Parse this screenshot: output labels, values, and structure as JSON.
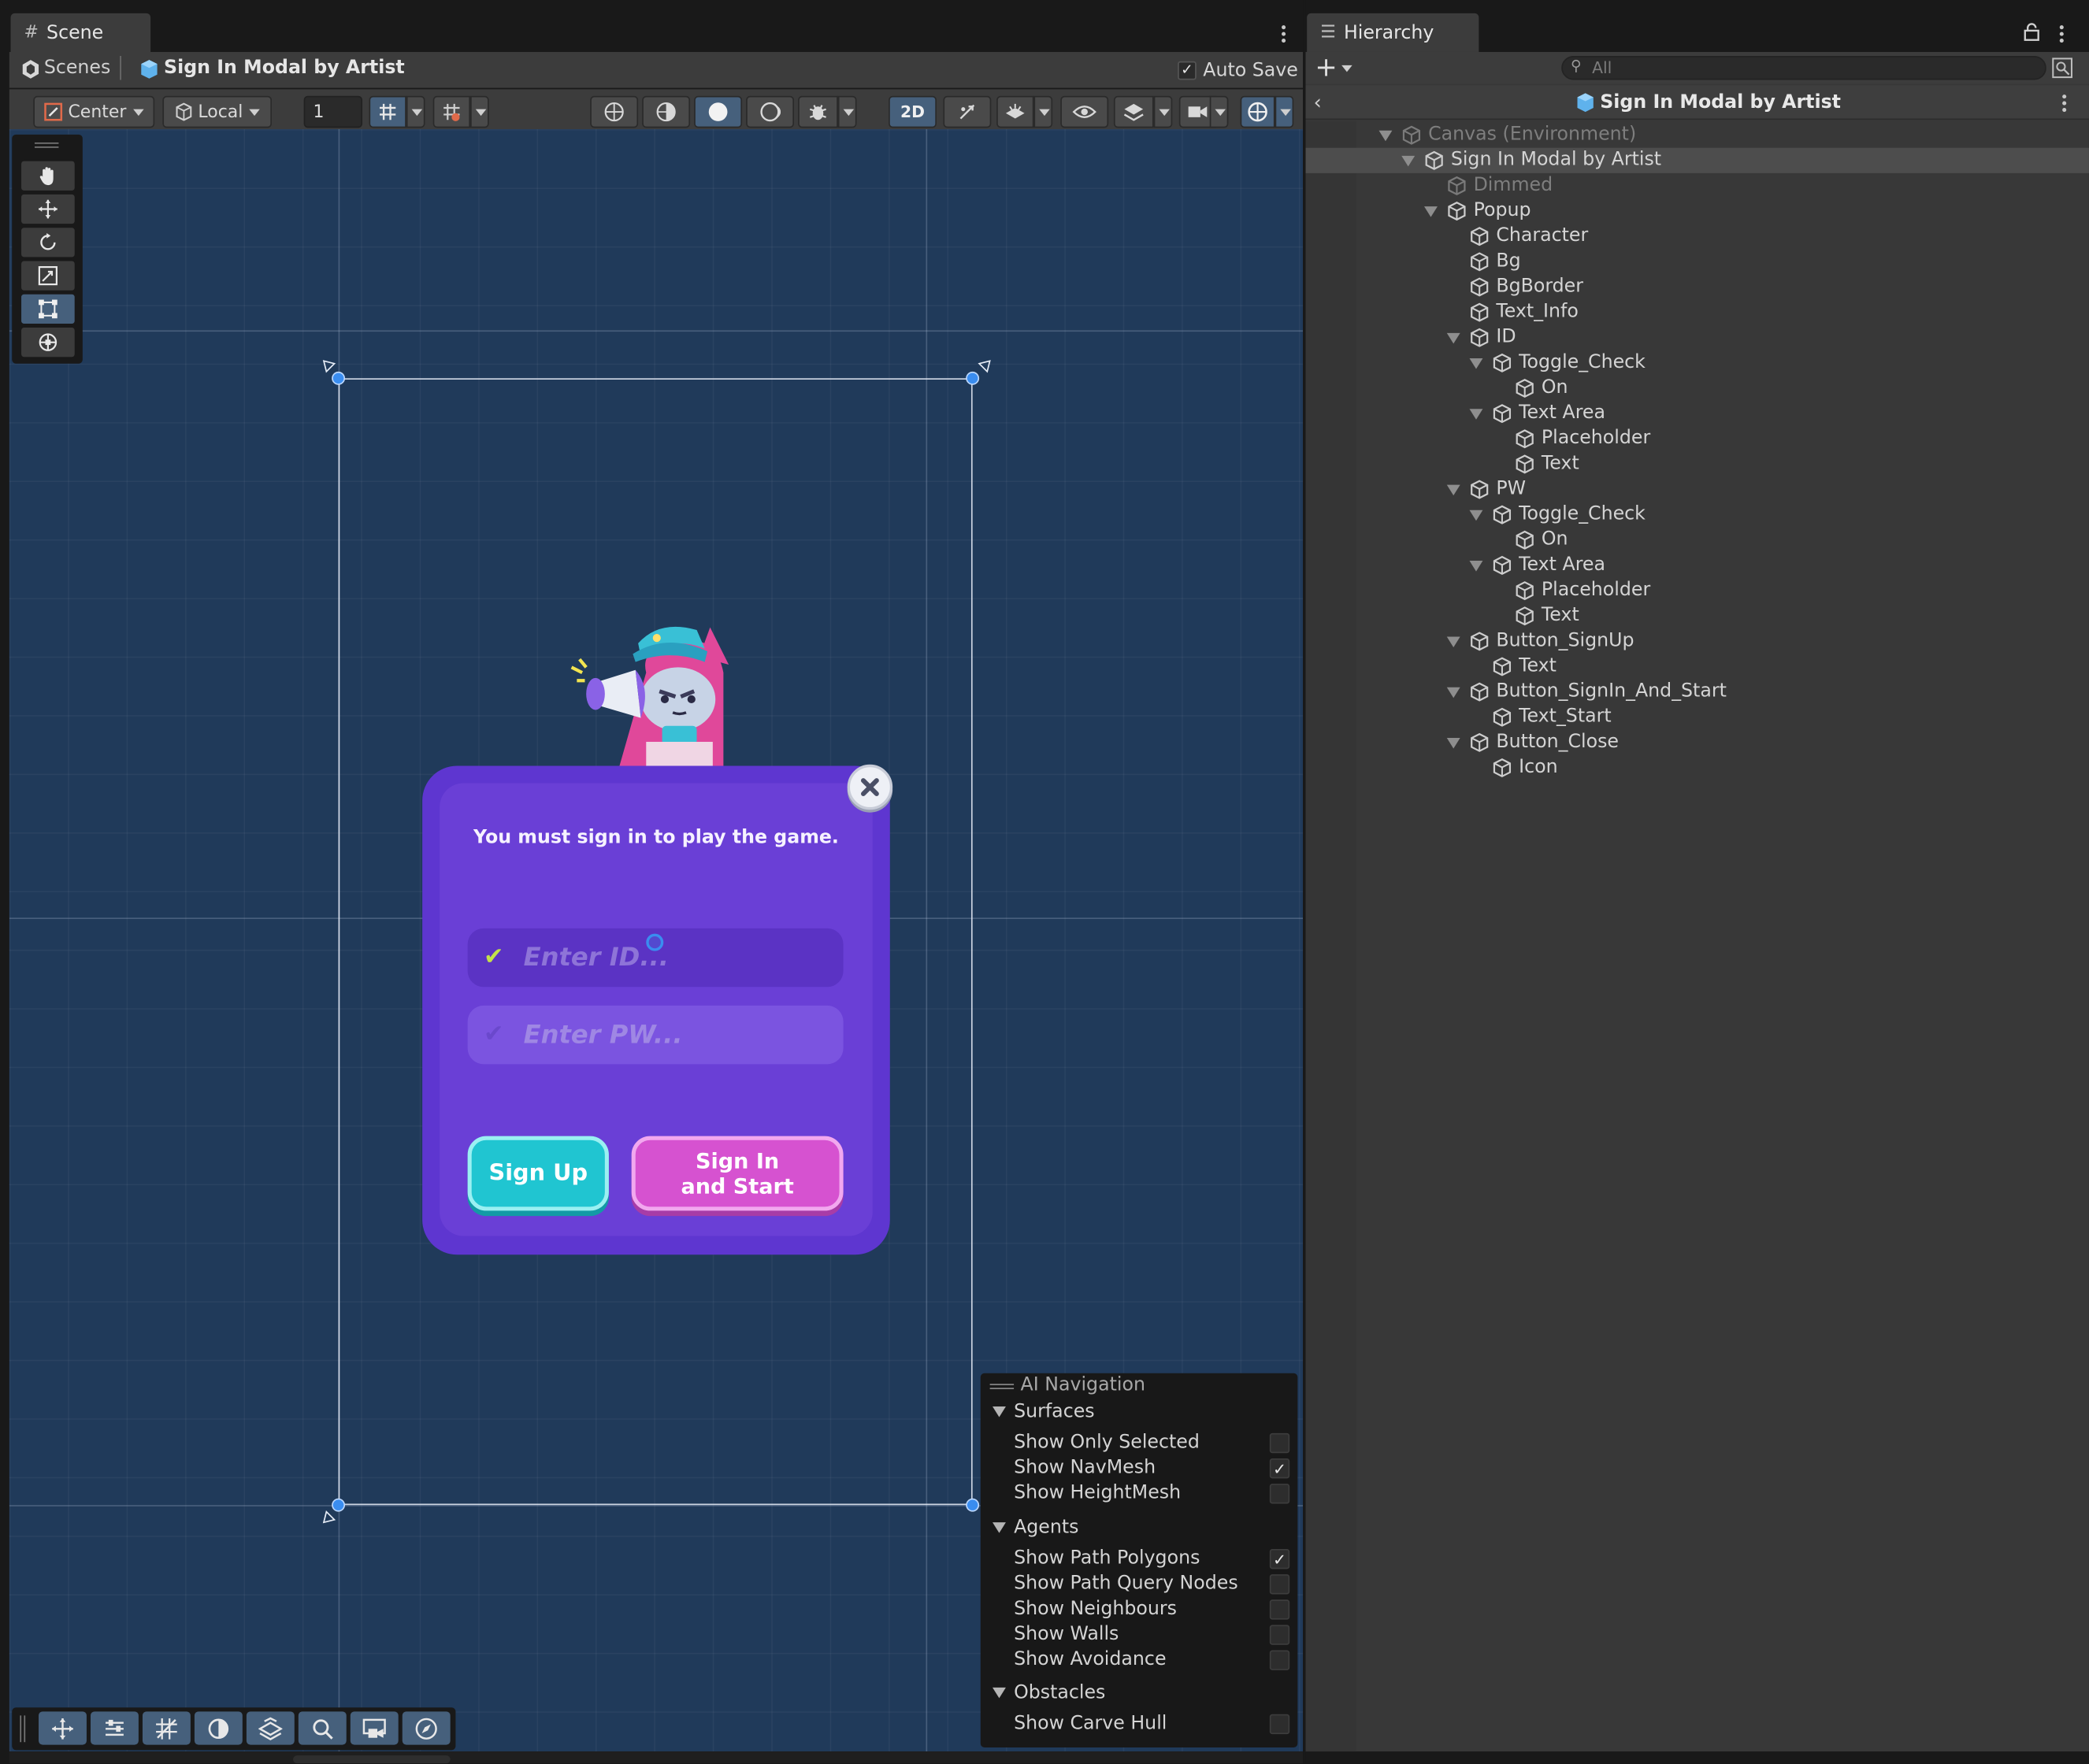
{
  "scene_tab": {
    "title": "Scene"
  },
  "scene_bar": {
    "scenes_label": "Scenes",
    "scene_name": "Sign In Modal by Artist",
    "auto_save_label": "Auto Save",
    "auto_save_checked": true
  },
  "toolbar": {
    "pivot_label": "Center",
    "space_label": "Local",
    "grid_snap_value": "1",
    "mode_2d_label": "2D"
  },
  "tools": [
    "hand-tool-icon",
    "move-tool-icon",
    "rotate-tool-icon",
    "scale-tool-icon",
    "rect-tool-icon",
    "transform-tool-icon"
  ],
  "popup": {
    "info_text": "You must sign in to play the game.",
    "id_placeholder": "Enter ID...",
    "pw_placeholder": "Enter PW...",
    "signup_label": "Sign Up",
    "signin_line1": "Sign In",
    "signin_line2": "and Start",
    "close_icon": "close-icon"
  },
  "ai_navigation": {
    "title": "AI Navigation",
    "sections": [
      {
        "name": "Surfaces",
        "items": [
          {
            "label": "Show Only Selected",
            "checked": false
          },
          {
            "label": "Show NavMesh",
            "checked": true
          },
          {
            "label": "Show HeightMesh",
            "checked": false
          }
        ]
      },
      {
        "name": "Agents",
        "items": [
          {
            "label": "Show Path Polygons",
            "checked": true
          },
          {
            "label": "Show Path Query Nodes",
            "checked": false
          },
          {
            "label": "Show Neighbours",
            "checked": false
          },
          {
            "label": "Show Walls",
            "checked": false
          },
          {
            "label": "Show Avoidance",
            "checked": false
          }
        ]
      },
      {
        "name": "Obstacles",
        "items": [
          {
            "label": "Show Carve Hull",
            "checked": false
          }
        ]
      }
    ]
  },
  "hierarchy": {
    "tab_title": "Hierarchy",
    "search_placeholder": "All",
    "header_title": "Sign In Modal by Artist",
    "items": [
      {
        "label": "Canvas (Environment)",
        "depth": 0,
        "expanded": true,
        "dim": true
      },
      {
        "label": "Sign In Modal by Artist",
        "depth": 1,
        "expanded": true,
        "selected": true
      },
      {
        "label": "Dimmed",
        "depth": 2,
        "dim": true
      },
      {
        "label": "Popup",
        "depth": 2,
        "expanded": true
      },
      {
        "label": "Character",
        "depth": 3
      },
      {
        "label": "Bg",
        "depth": 3
      },
      {
        "label": "BgBorder",
        "depth": 3
      },
      {
        "label": "Text_Info",
        "depth": 3
      },
      {
        "label": "ID",
        "depth": 3,
        "expanded": true
      },
      {
        "label": "Toggle_Check",
        "depth": 4,
        "expanded": true
      },
      {
        "label": "On",
        "depth": 5
      },
      {
        "label": "Text Area",
        "depth": 4,
        "expanded": true
      },
      {
        "label": "Placeholder",
        "depth": 5
      },
      {
        "label": "Text",
        "depth": 5
      },
      {
        "label": "PW",
        "depth": 3,
        "expanded": true
      },
      {
        "label": "Toggle_Check",
        "depth": 4,
        "expanded": true
      },
      {
        "label": "On",
        "depth": 5
      },
      {
        "label": "Text Area",
        "depth": 4,
        "expanded": true
      },
      {
        "label": "Placeholder",
        "depth": 5
      },
      {
        "label": "Text",
        "depth": 5
      },
      {
        "label": "Button_SignUp",
        "depth": 3,
        "expanded": true
      },
      {
        "label": "Text",
        "depth": 4
      },
      {
        "label": "Button_SignIn_And_Start",
        "depth": 3,
        "expanded": true
      },
      {
        "label": "Text_Start",
        "depth": 4
      },
      {
        "label": "Button_Close",
        "depth": 3,
        "expanded": true
      },
      {
        "label": "Icon",
        "depth": 4
      }
    ]
  },
  "colors": {
    "viewport_bg": "#203a5a",
    "popup_purple": "#6a3fd6",
    "signup_cyan": "#20c5d1",
    "signin_pink": "#d652d0",
    "selection_blue": "#46607c"
  }
}
